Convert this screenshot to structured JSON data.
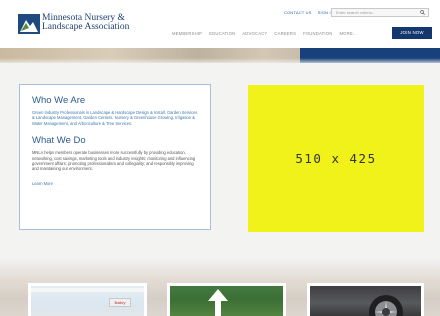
{
  "header": {
    "logo_line1": "Minnesota Nursery &",
    "logo_line2": "Landscape Association",
    "util_links": [
      "CONTACT US",
      "SIGN IN"
    ],
    "search_placeholder": "Enter search criteria...",
    "nav": [
      "MEMBERSHIP",
      "EDUCATION",
      "ADVOCACY",
      "CAREERS",
      "FOUNDATION",
      "MORE..."
    ],
    "join_label": "JOIN NOW"
  },
  "who": {
    "title": "Who We Are",
    "body": "Green Industry Professionals in Landscape & Hardscape Design & Install, Garden Services & Landscape Management, Garden Centers, Nursery & Greenhouse Growing, Irrigation & Water Management, and Arboriculture & Tree Services."
  },
  "what": {
    "title": "What We Do",
    "body": "MNLA helps members operate businesses more successfully by providing education, networking, cost savings, marketing tools and industry insights; monitoring and influencing government affairs; promoting professionalism and collegiality; and responsibly improving and maintaining our environment.",
    "link": "Learn More"
  },
  "ad": {
    "label": "510 x 425",
    "color": "#f1f21a"
  },
  "cards": {
    "sign_text": "Bailey"
  },
  "colors": {
    "brand_navy": "#14376d",
    "link_blue": "#3d77ad"
  }
}
